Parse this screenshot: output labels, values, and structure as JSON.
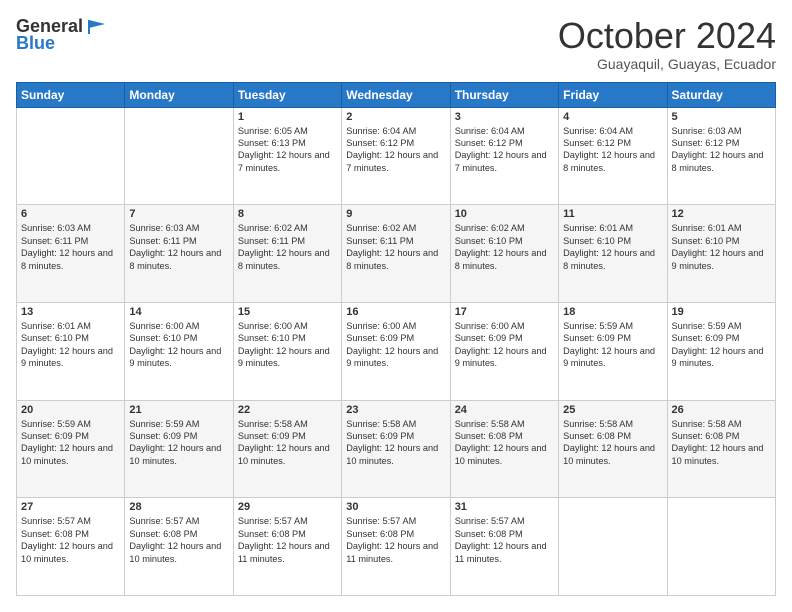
{
  "header": {
    "logo_general": "General",
    "logo_blue": "Blue",
    "month_title": "October 2024",
    "location": "Guayaquil, Guayas, Ecuador"
  },
  "days_of_week": [
    "Sunday",
    "Monday",
    "Tuesday",
    "Wednesday",
    "Thursday",
    "Friday",
    "Saturday"
  ],
  "weeks": [
    [
      {
        "day": "",
        "content": ""
      },
      {
        "day": "",
        "content": ""
      },
      {
        "day": "1",
        "content": "Sunrise: 6:05 AM\nSunset: 6:13 PM\nDaylight: 12 hours and 7 minutes."
      },
      {
        "day": "2",
        "content": "Sunrise: 6:04 AM\nSunset: 6:12 PM\nDaylight: 12 hours and 7 minutes."
      },
      {
        "day": "3",
        "content": "Sunrise: 6:04 AM\nSunset: 6:12 PM\nDaylight: 12 hours and 7 minutes."
      },
      {
        "day": "4",
        "content": "Sunrise: 6:04 AM\nSunset: 6:12 PM\nDaylight: 12 hours and 8 minutes."
      },
      {
        "day": "5",
        "content": "Sunrise: 6:03 AM\nSunset: 6:12 PM\nDaylight: 12 hours and 8 minutes."
      }
    ],
    [
      {
        "day": "6",
        "content": "Sunrise: 6:03 AM\nSunset: 6:11 PM\nDaylight: 12 hours and 8 minutes."
      },
      {
        "day": "7",
        "content": "Sunrise: 6:03 AM\nSunset: 6:11 PM\nDaylight: 12 hours and 8 minutes."
      },
      {
        "day": "8",
        "content": "Sunrise: 6:02 AM\nSunset: 6:11 PM\nDaylight: 12 hours and 8 minutes."
      },
      {
        "day": "9",
        "content": "Sunrise: 6:02 AM\nSunset: 6:11 PM\nDaylight: 12 hours and 8 minutes."
      },
      {
        "day": "10",
        "content": "Sunrise: 6:02 AM\nSunset: 6:10 PM\nDaylight: 12 hours and 8 minutes."
      },
      {
        "day": "11",
        "content": "Sunrise: 6:01 AM\nSunset: 6:10 PM\nDaylight: 12 hours and 8 minutes."
      },
      {
        "day": "12",
        "content": "Sunrise: 6:01 AM\nSunset: 6:10 PM\nDaylight: 12 hours and 9 minutes."
      }
    ],
    [
      {
        "day": "13",
        "content": "Sunrise: 6:01 AM\nSunset: 6:10 PM\nDaylight: 12 hours and 9 minutes."
      },
      {
        "day": "14",
        "content": "Sunrise: 6:00 AM\nSunset: 6:10 PM\nDaylight: 12 hours and 9 minutes."
      },
      {
        "day": "15",
        "content": "Sunrise: 6:00 AM\nSunset: 6:10 PM\nDaylight: 12 hours and 9 minutes."
      },
      {
        "day": "16",
        "content": "Sunrise: 6:00 AM\nSunset: 6:09 PM\nDaylight: 12 hours and 9 minutes."
      },
      {
        "day": "17",
        "content": "Sunrise: 6:00 AM\nSunset: 6:09 PM\nDaylight: 12 hours and 9 minutes."
      },
      {
        "day": "18",
        "content": "Sunrise: 5:59 AM\nSunset: 6:09 PM\nDaylight: 12 hours and 9 minutes."
      },
      {
        "day": "19",
        "content": "Sunrise: 5:59 AM\nSunset: 6:09 PM\nDaylight: 12 hours and 9 minutes."
      }
    ],
    [
      {
        "day": "20",
        "content": "Sunrise: 5:59 AM\nSunset: 6:09 PM\nDaylight: 12 hours and 10 minutes."
      },
      {
        "day": "21",
        "content": "Sunrise: 5:59 AM\nSunset: 6:09 PM\nDaylight: 12 hours and 10 minutes."
      },
      {
        "day": "22",
        "content": "Sunrise: 5:58 AM\nSunset: 6:09 PM\nDaylight: 12 hours and 10 minutes."
      },
      {
        "day": "23",
        "content": "Sunrise: 5:58 AM\nSunset: 6:09 PM\nDaylight: 12 hours and 10 minutes."
      },
      {
        "day": "24",
        "content": "Sunrise: 5:58 AM\nSunset: 6:08 PM\nDaylight: 12 hours and 10 minutes."
      },
      {
        "day": "25",
        "content": "Sunrise: 5:58 AM\nSunset: 6:08 PM\nDaylight: 12 hours and 10 minutes."
      },
      {
        "day": "26",
        "content": "Sunrise: 5:58 AM\nSunset: 6:08 PM\nDaylight: 12 hours and 10 minutes."
      }
    ],
    [
      {
        "day": "27",
        "content": "Sunrise: 5:57 AM\nSunset: 6:08 PM\nDaylight: 12 hours and 10 minutes."
      },
      {
        "day": "28",
        "content": "Sunrise: 5:57 AM\nSunset: 6:08 PM\nDaylight: 12 hours and 10 minutes."
      },
      {
        "day": "29",
        "content": "Sunrise: 5:57 AM\nSunset: 6:08 PM\nDaylight: 12 hours and 11 minutes."
      },
      {
        "day": "30",
        "content": "Sunrise: 5:57 AM\nSunset: 6:08 PM\nDaylight: 12 hours and 11 minutes."
      },
      {
        "day": "31",
        "content": "Sunrise: 5:57 AM\nSunset: 6:08 PM\nDaylight: 12 hours and 11 minutes."
      },
      {
        "day": "",
        "content": ""
      },
      {
        "day": "",
        "content": ""
      }
    ]
  ]
}
